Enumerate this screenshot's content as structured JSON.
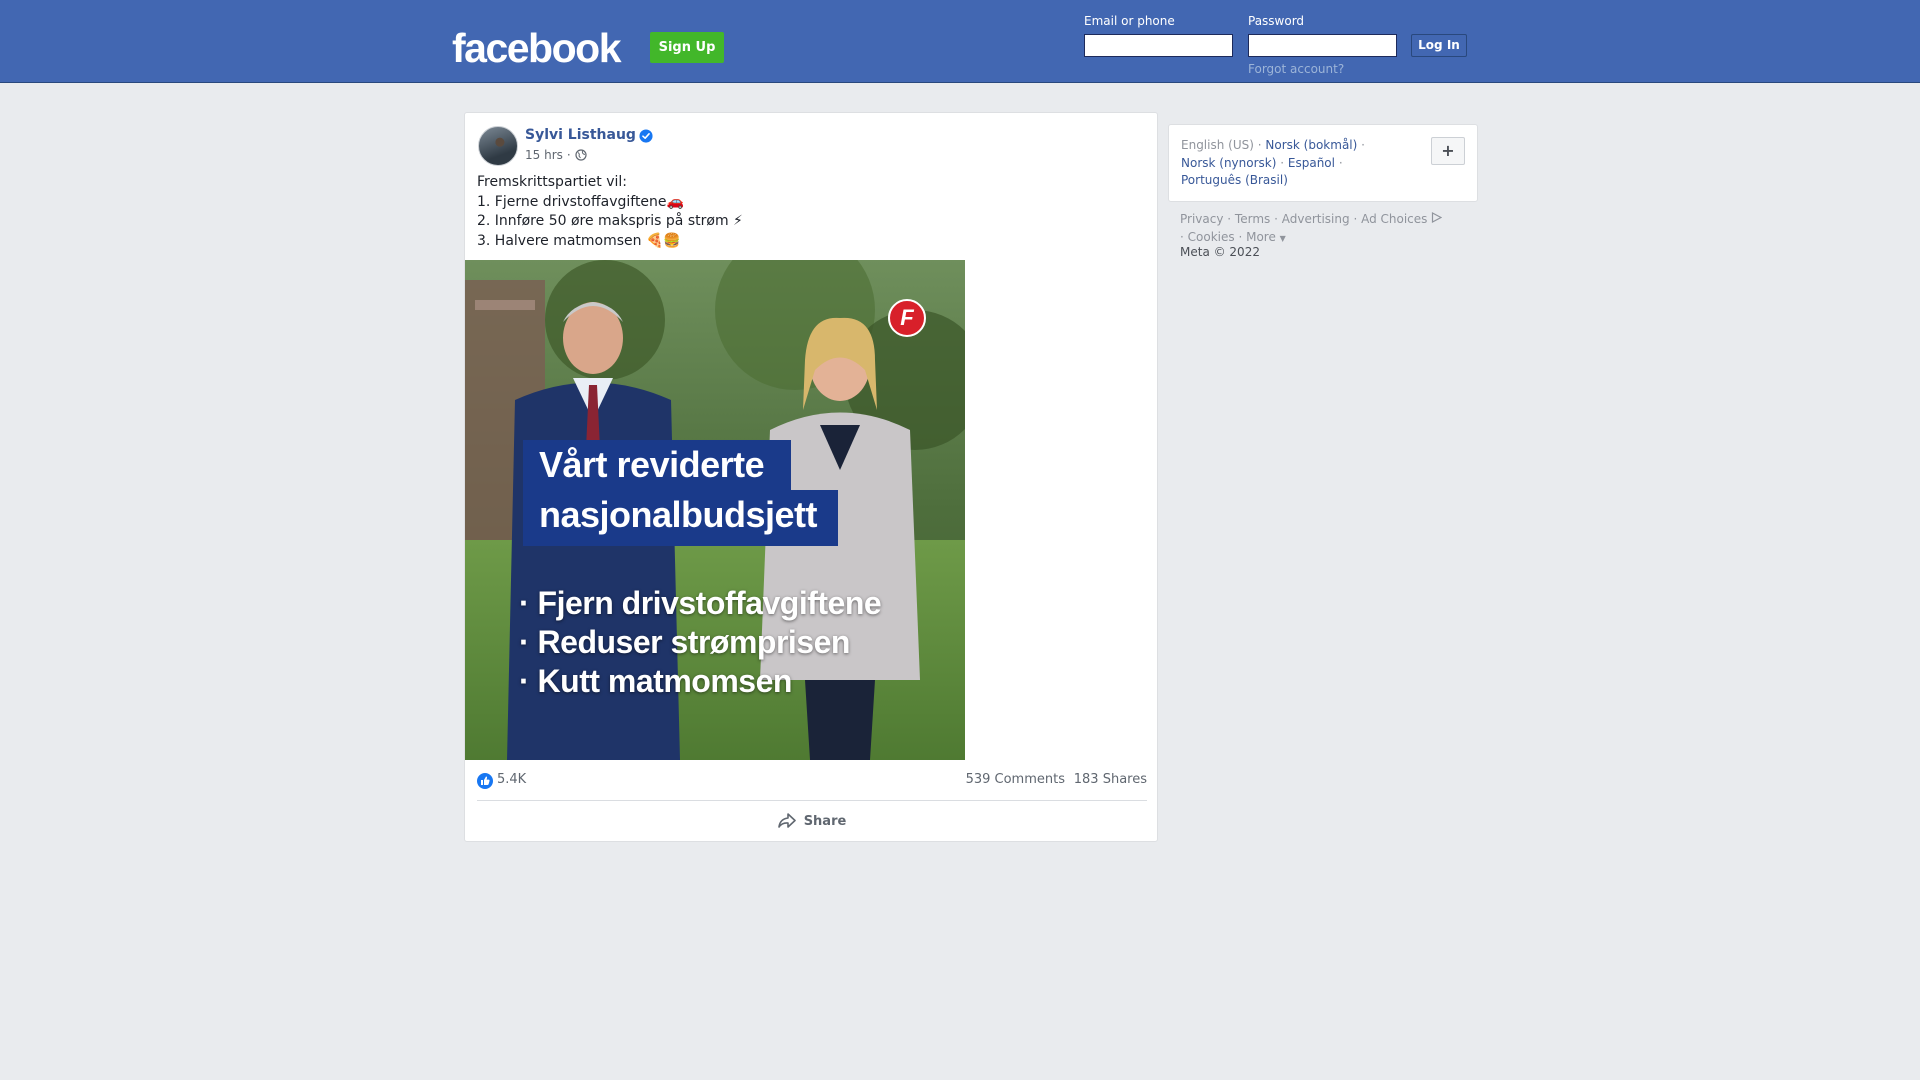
{
  "header": {
    "logo": "facebook",
    "signup_label": "Sign Up",
    "email_label": "Email or phone",
    "email_value": "",
    "password_label": "Password",
    "password_value": "",
    "login_label": "Log In",
    "forgot_label": "Forgot account?"
  },
  "post": {
    "author": "Sylvi Listhaug",
    "verified": true,
    "time": "15 hrs",
    "audience_icon": "globe-icon",
    "text_lines": [
      "Fremskrittspartiet vil:",
      "1. Fjerne drivstoffavgiftene🚗",
      "2. Innføre 50 øre makspris på strøm ⚡",
      "3. Halvere matmomsen 🍕🍔"
    ],
    "image": {
      "heading_line1": "Vårt reviderte",
      "heading_line2": "nasjonalbudsjett",
      "bullets": [
        "· Fjern drivstoffavgiftene",
        "· Reduser strømprisen",
        "· Kutt matmomsen"
      ],
      "party_logo_letter": "F"
    },
    "likes": "5.4K",
    "comments": "539 Comments",
    "shares": "183 Shares",
    "share_label": "Share"
  },
  "languages": {
    "items": [
      {
        "label": "English (US)",
        "current": true
      },
      {
        "label": "Norsk (bokmål)",
        "current": false
      },
      {
        "label": "Norsk (nynorsk)",
        "current": false
      },
      {
        "label": "Español",
        "current": false
      },
      {
        "label": "Português (Brasil)",
        "current": false
      }
    ],
    "more_label": "+"
  },
  "footer": {
    "privacy": "Privacy",
    "terms": "Terms",
    "advertising": "Advertising",
    "ad_choices": "Ad Choices",
    "cookies": "Cookies",
    "more": "More",
    "copyright": "Meta © 2022"
  },
  "colors": {
    "brand_blue": "#4267b2",
    "signup_green": "#42b72a",
    "link_blue": "#385898",
    "banner_blue": "#1a3a8a"
  }
}
